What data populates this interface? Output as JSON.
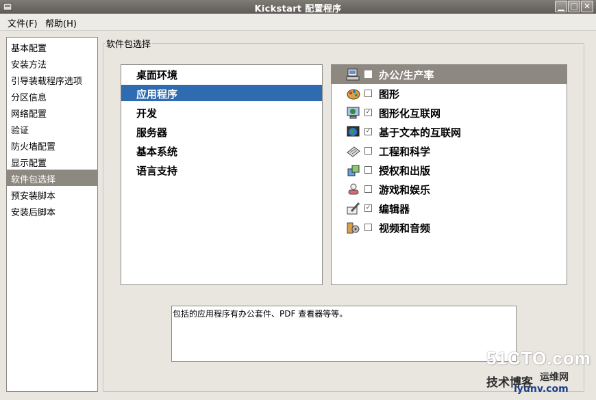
{
  "window": {
    "title": "Kickstart 配置程序"
  },
  "menu": [
    {
      "label": "文件(F)"
    },
    {
      "label": "帮助(H)"
    }
  ],
  "sidebar": {
    "items": [
      {
        "label": "基本配置"
      },
      {
        "label": "安装方法"
      },
      {
        "label": "引导装载程序选项"
      },
      {
        "label": "分区信息"
      },
      {
        "label": "网络配置"
      },
      {
        "label": "验证"
      },
      {
        "label": "防火墙配置"
      },
      {
        "label": "显示配置"
      },
      {
        "label": "软件包选择",
        "selected": true
      },
      {
        "label": "预安装脚本"
      },
      {
        "label": "安装后脚本"
      }
    ]
  },
  "group_title": "软件包选择",
  "categories": [
    {
      "label": "桌面环境"
    },
    {
      "label": "应用程序",
      "selected": true
    },
    {
      "label": "开发"
    },
    {
      "label": "服务器"
    },
    {
      "label": "基本系统"
    },
    {
      "label": "语言支持"
    }
  ],
  "packages": [
    {
      "label": "办公/生产率",
      "checked": false,
      "icon": "office-icon",
      "selected": true
    },
    {
      "label": "图形",
      "checked": false,
      "icon": "graphics-icon"
    },
    {
      "label": "图形化互联网",
      "checked": true,
      "icon": "graphical-internet-icon"
    },
    {
      "label": "基于文本的互联网",
      "checked": true,
      "icon": "text-internet-icon"
    },
    {
      "label": "工程和科学",
      "checked": false,
      "icon": "engineering-icon"
    },
    {
      "label": "授权和出版",
      "checked": false,
      "icon": "publishing-icon"
    },
    {
      "label": "游戏和娱乐",
      "checked": false,
      "icon": "games-icon"
    },
    {
      "label": "编辑器",
      "checked": true,
      "icon": "editors-icon"
    },
    {
      "label": "视频和音频",
      "checked": false,
      "icon": "sound-video-icon"
    }
  ],
  "description": "包括的应用程序有办公套件、PDF 查看器等等。",
  "watermark": {
    "line1": "51CTO.com",
    "line2": "技术博客",
    "line3": "运维网",
    "line4": "iyunv.com"
  },
  "colors": {
    "selection_blue": "#2f6bb0",
    "selection_gray": "#8e8980"
  }
}
